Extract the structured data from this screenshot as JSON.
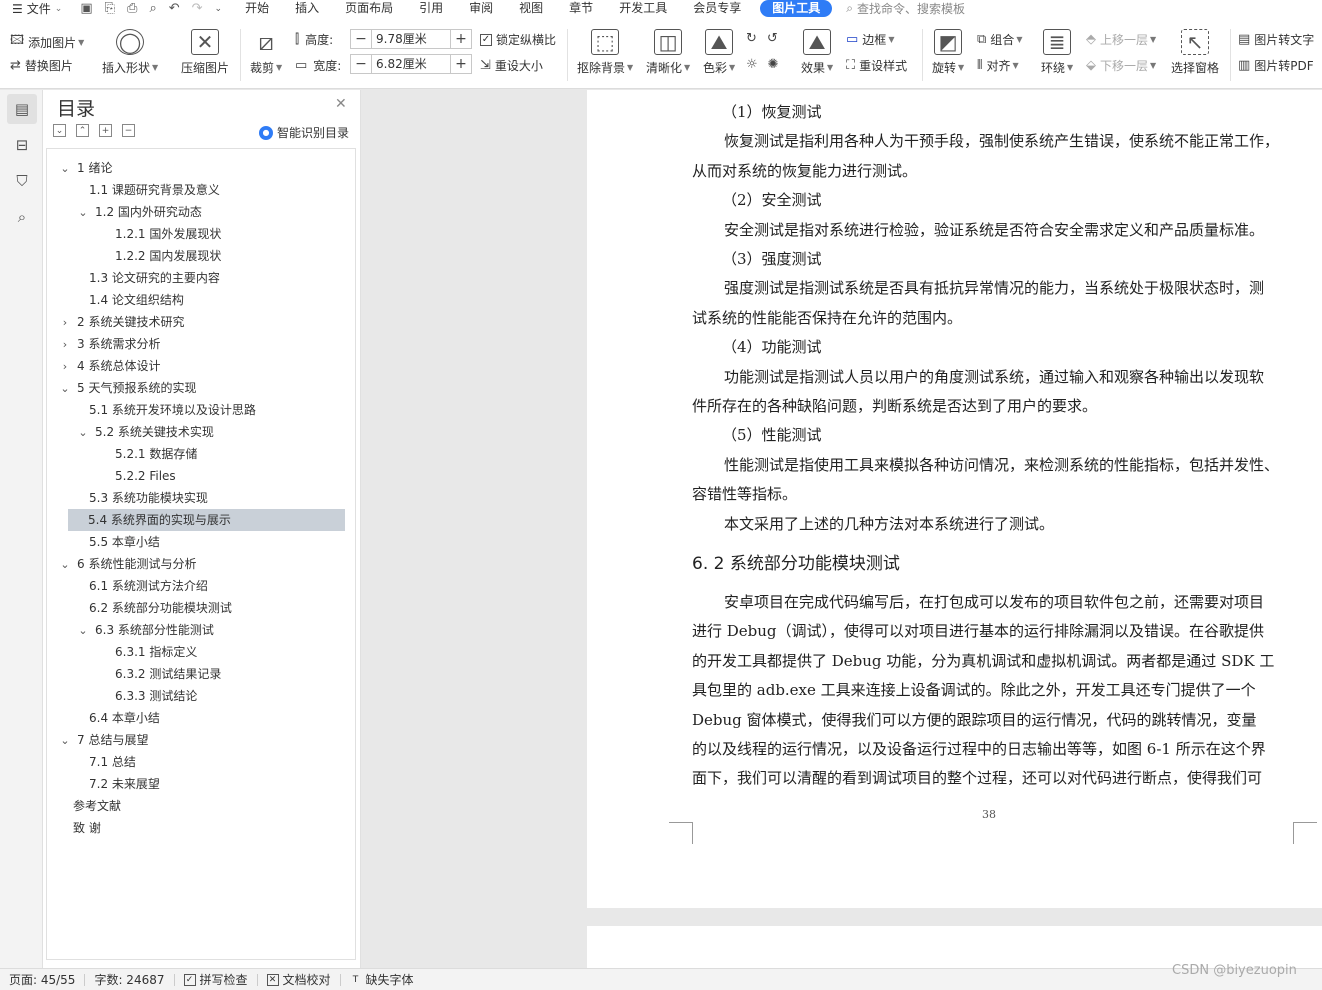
{
  "menubar": {
    "file_label": "文件",
    "tabs": [
      "开始",
      "插入",
      "页面布局",
      "引用",
      "审阅",
      "视图",
      "章节",
      "开发工具",
      "会员专享"
    ],
    "active_tab": "图片工具",
    "search_placeholder": "查找命令、搜索模板"
  },
  "ribbon": {
    "add_image": "添加图片",
    "replace_image": "替换图片",
    "insert_shape": "插入形状",
    "compress_image": "压缩图片",
    "crop": "裁剪",
    "height_label": "高度:",
    "height_value": "9.78厘米",
    "width_label": "宽度:",
    "width_value": "6.82厘米",
    "lock_ratio": "锁定纵横比",
    "reset_size": "重设大小",
    "remove_bg": "抠除背景",
    "sharpen": "清晰化",
    "color": "色彩",
    "effect": "效果",
    "border": "边框",
    "reset_style": "重设样式",
    "rotate": "旋转",
    "group": "组合",
    "align": "对齐",
    "wrap": "环绕",
    "bring_forward": "上移一层",
    "send_backward": "下移一层",
    "selection_pane": "选择窗格",
    "img_to_text": "图片转文字",
    "img_to_pdf": "图片转PDF"
  },
  "toc": {
    "title": "目录",
    "smart_label": "智能识别目录",
    "items": [
      {
        "text": "1   绪论",
        "level": 1,
        "chev": "v"
      },
      {
        "text": "1.1 课题研究背景及意义",
        "level": 2,
        "chev": ""
      },
      {
        "text": "1.2 国内外研究动态",
        "level": 2,
        "chev": "v"
      },
      {
        "text": "1.2.1 国外发展现状",
        "level": 3,
        "chev": ""
      },
      {
        "text": "1.2.2 国内发展现状",
        "level": 3,
        "chev": ""
      },
      {
        "text": "1.3 论文研究的主要内容",
        "level": 2,
        "chev": ""
      },
      {
        "text": "1.4 论文组织结构",
        "level": 2,
        "chev": ""
      },
      {
        "text": "2   系统关键技术研究",
        "level": 1,
        "chev": ">"
      },
      {
        "text": "3   系统需求分析",
        "level": 1,
        "chev": ">"
      },
      {
        "text": "4   系统总体设计",
        "level": 1,
        "chev": ">"
      },
      {
        "text": "5   天气预报系统的实现",
        "level": 1,
        "chev": "v"
      },
      {
        "text": "5.1 系统开发环境以及设计思路",
        "level": 2,
        "chev": ""
      },
      {
        "text": "5.2 系统关键技术实现",
        "level": 2,
        "chev": "v"
      },
      {
        "text": "5.2.1 数据存储",
        "level": 3,
        "chev": ""
      },
      {
        "text": "5.2.2 Files",
        "level": 3,
        "chev": ""
      },
      {
        "text": "5.3 系统功能模块实现",
        "level": 2,
        "chev": ""
      },
      {
        "text": "5.4 系统界面的实现与展示",
        "level": 2,
        "chev": "",
        "selected": true
      },
      {
        "text": "5.5 本章小结",
        "level": 2,
        "chev": ""
      },
      {
        "text": "6   系统性能测试与分析",
        "level": 1,
        "chev": "v"
      },
      {
        "text": "6.1 系统测试方法介绍",
        "level": 2,
        "chev": ""
      },
      {
        "text": "6.2 系统部分功能模块测试",
        "level": 2,
        "chev": ""
      },
      {
        "text": "6.3 系统部分性能测试",
        "level": 2,
        "chev": "v"
      },
      {
        "text": "6.3.1 指标定义",
        "level": 3,
        "chev": ""
      },
      {
        "text": "6.3.2 测试结果记录",
        "level": 3,
        "chev": ""
      },
      {
        "text": "6.3.3 测试结论",
        "level": 3,
        "chev": ""
      },
      {
        "text": "6.4 本章小结",
        "level": 2,
        "chev": ""
      },
      {
        "text": "7   总结与展望",
        "level": 1,
        "chev": "v"
      },
      {
        "text": "7.1 总结",
        "level": 2,
        "chev": ""
      },
      {
        "text": "7.2 未来展望",
        "level": 2,
        "chev": ""
      },
      {
        "text": "参考文献",
        "level": 0,
        "chev": ""
      },
      {
        "text": "致   谢",
        "level": 0,
        "chev": ""
      }
    ]
  },
  "document": {
    "blocks": [
      {
        "type": "sub",
        "lines": [
          "（1）恢复测试"
        ]
      },
      {
        "type": "body",
        "lines": [
          "恢复测试是指利用各种人为干预手段，强制使系统产生错误，使系统不能正常工作，",
          "从而对系统的恢复能力进行测试。"
        ]
      },
      {
        "type": "sub",
        "lines": [
          "（2）安全测试"
        ]
      },
      {
        "type": "body",
        "lines": [
          "安全测试是指对系统进行检验，验证系统是否符合安全需求定义和产品质量标准。"
        ]
      },
      {
        "type": "sub",
        "lines": [
          "（3）强度测试"
        ]
      },
      {
        "type": "body",
        "lines": [
          "强度测试是指测试系统是否具有抵抗异常情况的能力，当系统处于极限状态时，测",
          "试系统的性能能否保持在允许的范围内。"
        ]
      },
      {
        "type": "sub",
        "lines": [
          "（4）功能测试"
        ]
      },
      {
        "type": "body",
        "lines": [
          "功能测试是指测试人员以用户的角度测试系统，通过输入和观察各种输出以发现软",
          "件所存在的各种缺陷问题，判断系统是否达到了用户的要求。"
        ]
      },
      {
        "type": "sub",
        "lines": [
          "（5）性能测试"
        ]
      },
      {
        "type": "body",
        "lines": [
          "性能测试是指使用工具来模拟各种访问情况，来检测系统的性能指标，包括并发性、",
          "容错性等指标。"
        ]
      },
      {
        "type": "body",
        "lines": [
          "本文采用了上述的几种方法对本系统进行了测试。"
        ]
      }
    ],
    "heading": "6. 2 系统部分功能模块测试",
    "para2": [
      "安卓项目在完成代码编写后，在打包成可以发布的项目软件包之前，还需要对项目",
      "进行 Debug（调试），使得可以对项目进行基本的运行排除漏洞以及错误。在谷歌提供",
      "的开发工具都提供了 Debug 功能，分为真机调试和虚拟机调试。两者都是通过 SDK 工",
      "具包里的 adb.exe 工具来连接上设备调试的。除此之外，开发工具还专门提供了一个",
      "Debug 窗体模式，使得我们可以方便的跟踪项目的运行情况，代码的跳转情况，变量",
      "的以及线程的运行情况，以及设备运行过程中的日志输出等等，如图 6-1 所示在这个界",
      "面下，我们可以清醒的看到调试项目的整个过程，还可以对代码进行断点，使得我们可"
    ],
    "page_number": "38"
  },
  "status": {
    "page": "页面: 45/55",
    "words": "字数: 24687",
    "spell": "拼写检查",
    "proof": "文档校对",
    "missing_font": "缺失字体"
  },
  "watermark": "CSDN @biyezuopin"
}
